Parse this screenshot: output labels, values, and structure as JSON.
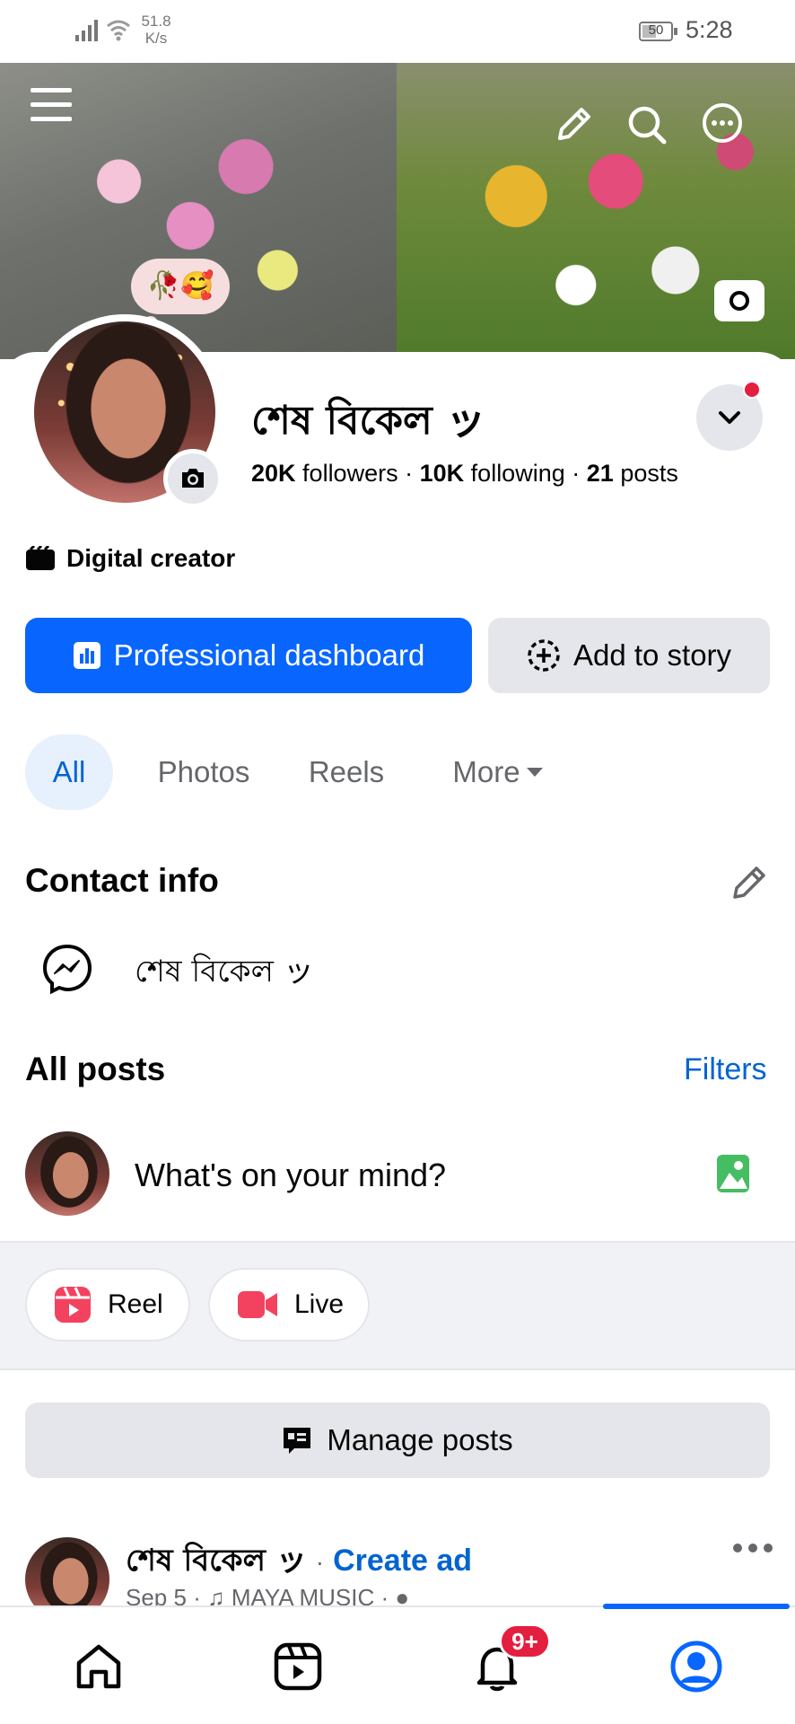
{
  "status_bar": {
    "net_speed_value": "51.8",
    "net_speed_unit": "K/s",
    "battery": "50",
    "time": "5:28"
  },
  "profile": {
    "note_emoji": "🥀🥰",
    "name": "শেষ বিকেল ッ",
    "followers_count": "20K",
    "followers_label": "followers",
    "following_count": "10K",
    "following_label": "following",
    "posts_count": "21",
    "posts_label": "posts",
    "separator": "·",
    "category": "Digital creator"
  },
  "actions": {
    "dashboard_label": "Professional dashboard",
    "add_story_label": "Add to story"
  },
  "tabs": [
    {
      "label": "All"
    },
    {
      "label": "Photos"
    },
    {
      "label": "Reels"
    },
    {
      "label": "More"
    }
  ],
  "contact": {
    "title": "Contact info",
    "messenger_value": "শেষ বিকেল ッ"
  },
  "posts": {
    "title": "All posts",
    "filters_label": "Filters",
    "composer_placeholder": "What's on your mind?",
    "reel_label": "Reel",
    "live_label": "Live",
    "manage_label": "Manage posts"
  },
  "first_post": {
    "author": "শেষ বিকেল ッ",
    "create_ad": "Create ad",
    "date": "Sep 5",
    "music": "MAYA MUSIC"
  },
  "notifications_badge": "9+",
  "colors": {
    "accent": "#0866ff",
    "link": "#0064d1",
    "badge": "#e41e3f",
    "button_gray": "#e4e6eb"
  }
}
